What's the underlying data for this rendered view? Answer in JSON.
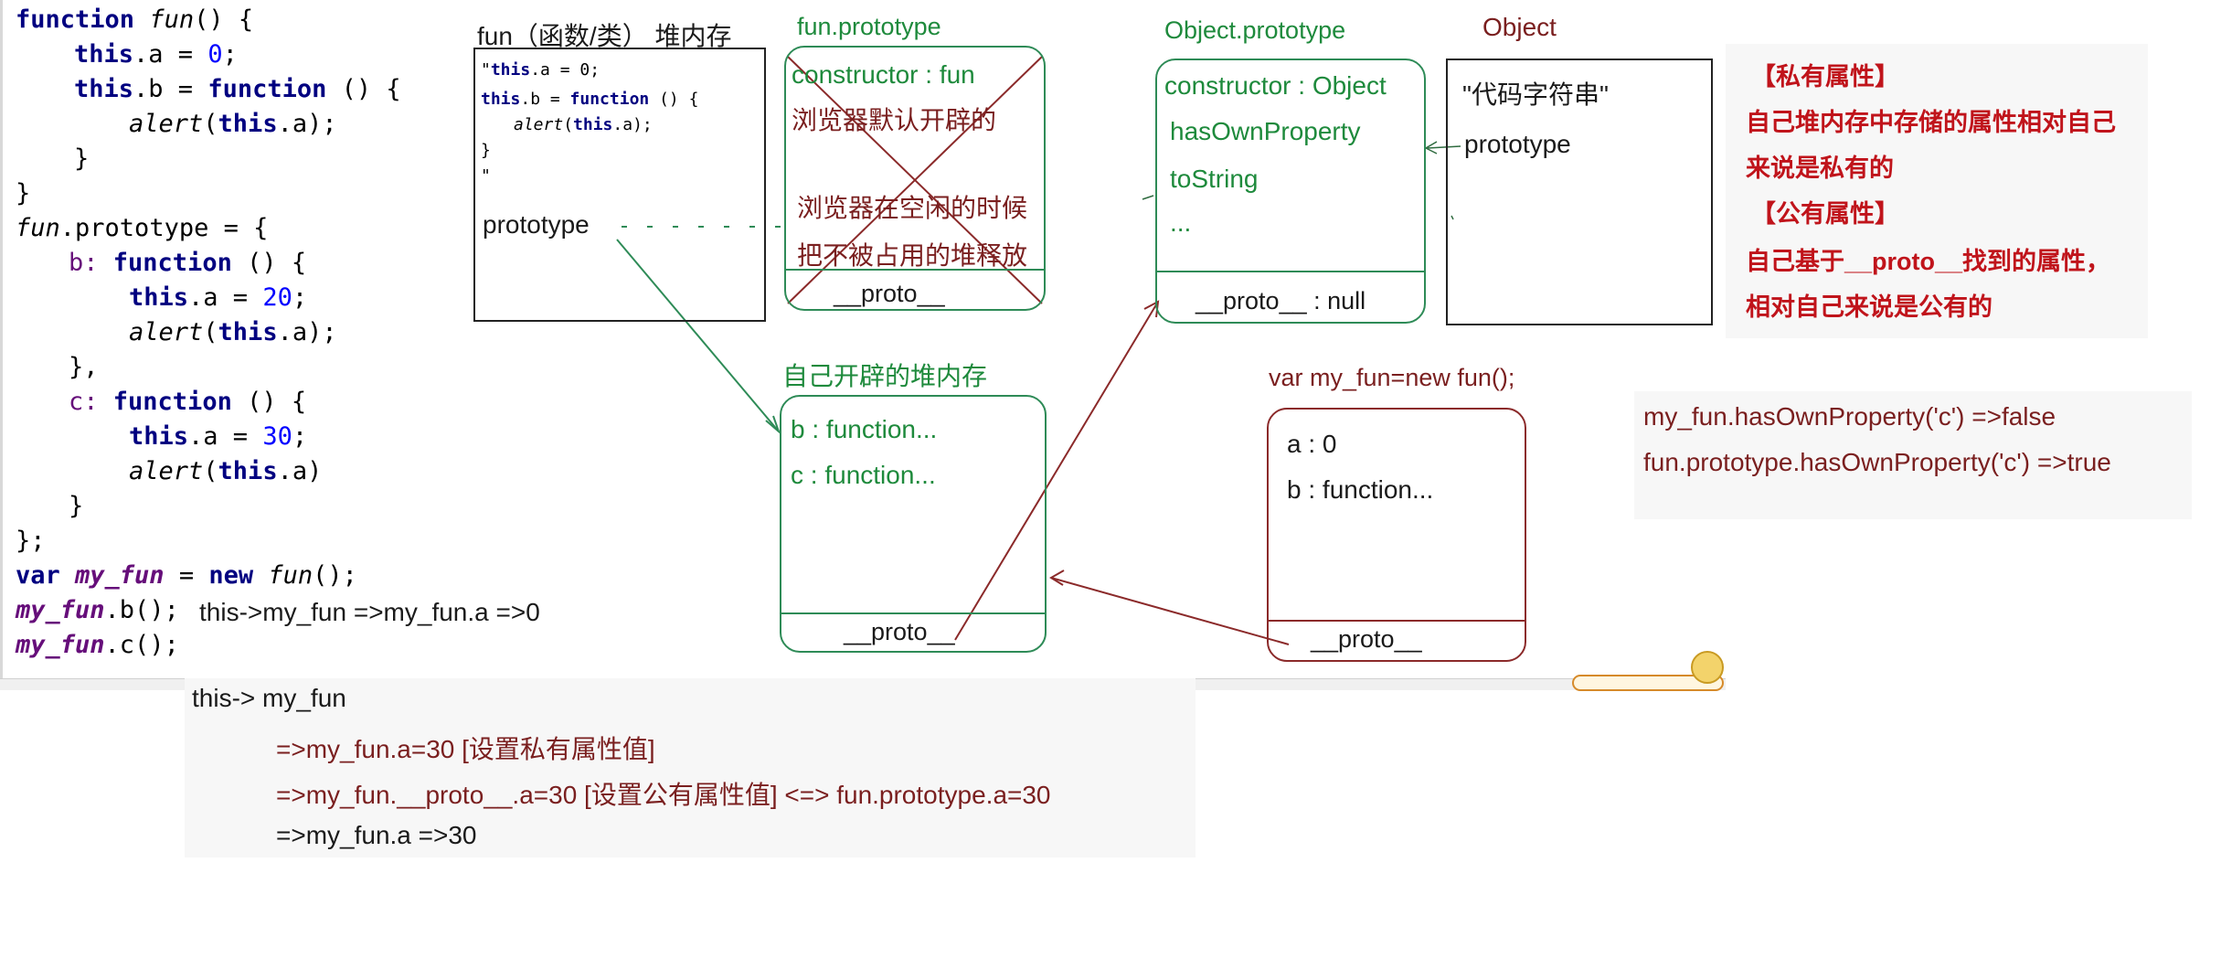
{
  "code": {
    "lines": [
      {
        "a": "function ",
        "b": "fun",
        "c": "() {"
      },
      {
        "a": "this",
        "b": ".a = ",
        "c": "0",
        "d": ";"
      },
      {
        "a": "this",
        "b": ".b = ",
        "c": "function",
        "d": " () {"
      },
      {
        "a": "alert",
        "b": "(",
        "c": "this",
        "d": ".a);"
      },
      {
        "a": "}"
      },
      {
        "a": "}"
      },
      {
        "a": "fun",
        "b": ".prototype = {"
      },
      {
        "a": "b: ",
        "b": "function",
        "c": " () {"
      },
      {
        "a": "this",
        "b": ".a = ",
        "c": "20",
        "d": ";"
      },
      {
        "a": "alert",
        "b": "(",
        "c": "this",
        "d": ".a);"
      },
      {
        "a": "},"
      },
      {
        "a": "c: ",
        "b": "function",
        "c": " () {"
      },
      {
        "a": "this",
        "b": ".a = ",
        "c": "30",
        "d": ";"
      },
      {
        "a": "alert",
        "b": "(",
        "c": "this",
        "d": ".a)"
      },
      {
        "a": "}"
      },
      {
        "a": "};"
      },
      {
        "a": "var ",
        "b": "my_fun",
        "c": " = ",
        "d": "new ",
        "e": "fun",
        "f": "();"
      },
      {
        "a": "my_fun",
        "b": ".b();",
        "c": "this->my_fun  =>my_fun.a  =>0"
      },
      {
        "a": "my_fun",
        "b": ".c();"
      }
    ]
  },
  "fun_heap": {
    "title": "fun（函数/类） 堆内存",
    "code_lines": [
      {
        "a": "\"",
        "b": "this",
        "c": ".a = 0;"
      },
      {
        "a": "this",
        "b": ".b = ",
        "c": "function",
        "d": " () {"
      },
      {
        "a": "alert",
        "b": "(",
        "c": "this",
        "d": ".a);"
      },
      {
        "a": "}"
      },
      {
        "a": "\""
      }
    ],
    "prototype_label": "prototype"
  },
  "fun_prototype": {
    "title": "fun.prototype",
    "constructor": "constructor : fun",
    "note1": "浏览器默认开辟的",
    "note2": "浏览器在空闲的时候",
    "note3": "把不被占用的堆释放",
    "proto": "__proto__"
  },
  "object_prototype": {
    "title": "Object.prototype",
    "items": [
      "constructor : Object",
      "hasOwnProperty",
      "toString",
      "..."
    ],
    "proto": "__proto__ : null"
  },
  "object": {
    "title": "Object",
    "code_string": "\"代码字符串\"",
    "prototype_label": "prototype"
  },
  "self_heap": {
    "title": "自己开辟的堆内存",
    "items": [
      "b : function...",
      "c : function..."
    ],
    "proto": "__proto__"
  },
  "instance": {
    "title": "var my_fun=new fun();",
    "items": [
      "a : 0",
      "b : function..."
    ],
    "proto": "__proto__"
  },
  "notes_private_public": {
    "private_title": "【私有属性】",
    "private_text1": "自己堆内存中存储的属性相对自己",
    "private_text2": "来说是私有的",
    "public_title": "【公有属性】",
    "public_text1": "自己基于__proto__找到的属性，",
    "public_text2": "相对自己来说是公有的"
  },
  "has_own": {
    "line1": "my_fun.hasOwnProperty('c') =>false",
    "line2": "fun.prototype.hasOwnProperty('c') =>true"
  },
  "explanation": {
    "line1": "this-> my_fun",
    "line2": "=>my_fun.a=30   [设置私有属性值]",
    "line3": "=>my_fun.__proto__.a=30 [设置公有属性值]    <=> fun.prototype.a=30",
    "line4": "=>my_fun.a  =>30"
  },
  "colors": {
    "green": "#1e8a3c",
    "brown": "#8b1a1a",
    "red": "#c0141b",
    "dark": "#1a1a1a"
  }
}
